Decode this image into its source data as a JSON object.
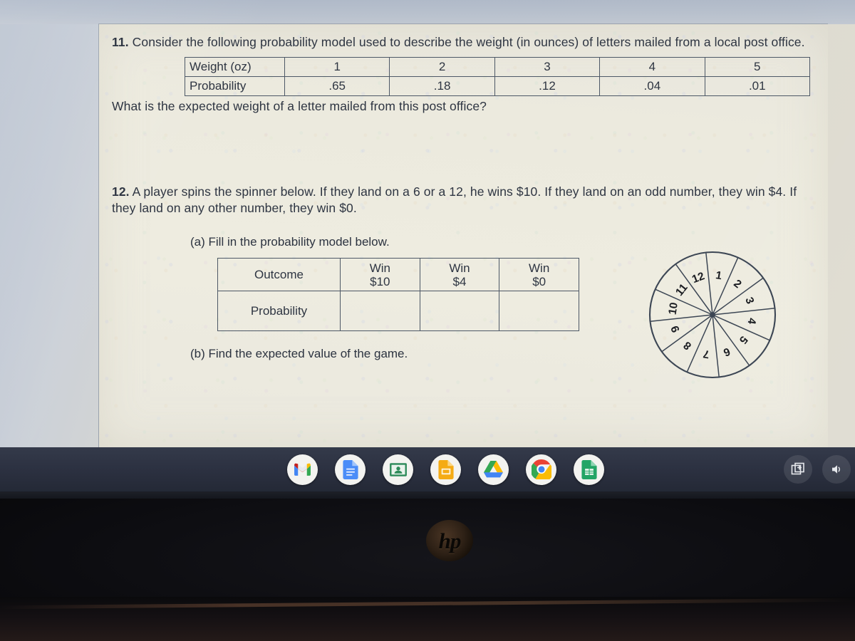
{
  "question_11": {
    "number": "11.",
    "text": " Consider the following probability model used to describe the weight (in ounces) of letters mailed from a local post office.",
    "table": {
      "row_labels": [
        "Weight (oz)",
        "Probability"
      ],
      "weights": [
        "1",
        "2",
        "3",
        "4",
        "5"
      ],
      "probabilities": [
        ".65",
        ".18",
        ".12",
        ".04",
        ".01"
      ]
    },
    "followup": "What is the expected weight of a letter mailed from this post office?"
  },
  "question_12": {
    "number": "12.",
    "text": " A player spins the spinner below.  If they land on a 6 or a 12, he wins $10.  If they land on an odd number, they win $4.  If they land on any other number, they win $0.",
    "part_a": "(a)  Fill in the probability model below.",
    "table": {
      "row_labels": [
        "Outcome",
        "Probability"
      ],
      "outcomes": [
        {
          "line1": "Win",
          "line2": "$10"
        },
        {
          "line1": "Win",
          "line2": "$4"
        },
        {
          "line1": "Win",
          "line2": "$0"
        }
      ],
      "probabilities": [
        "",
        "",
        ""
      ]
    },
    "part_b": "(b)  Find the expected value of the game.",
    "spinner": {
      "sectors": 12,
      "labels": [
        "1",
        "2",
        "3",
        "4",
        "5",
        "6",
        "7",
        "8",
        "9",
        "10",
        "11",
        "12"
      ]
    }
  },
  "shelf": {
    "apps": [
      {
        "name": "gmail-app-icon",
        "label": "Gmail"
      },
      {
        "name": "docs-app-icon",
        "label": "Docs"
      },
      {
        "name": "classroom-app-icon",
        "label": "Classroom"
      },
      {
        "name": "slides-app-icon",
        "label": "Slides"
      },
      {
        "name": "drive-app-icon",
        "label": "Drive"
      },
      {
        "name": "chrome-app-icon",
        "label": "Chrome"
      },
      {
        "name": "sheets-app-icon",
        "label": "Sheets"
      }
    ],
    "system": [
      {
        "name": "screen-capture-icon",
        "label": "Screen capture"
      },
      {
        "name": "volume-icon",
        "label": "Volume"
      }
    ]
  },
  "device": {
    "brand_logo": "hp"
  },
  "colors": {
    "shelf": "#2b3040",
    "paper": "#eceade",
    "ink": "#2e3542",
    "rule": "#4d5866"
  }
}
